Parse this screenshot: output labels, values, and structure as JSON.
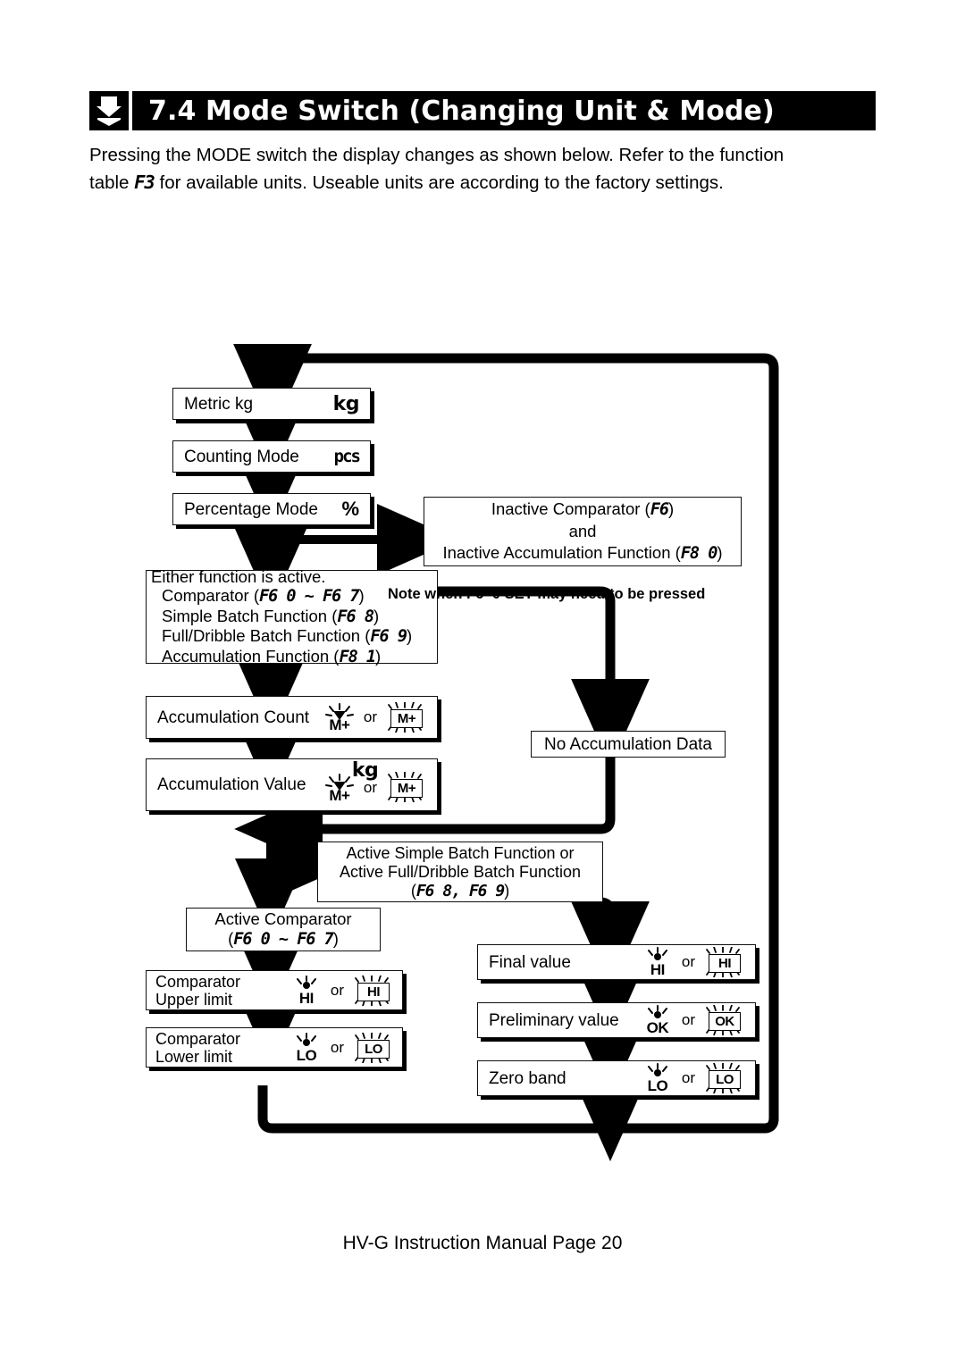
{
  "header": {
    "title": "7.4 Mode Switch (Changing Unit & Mode)",
    "icon": "down-arrow-mark-icon"
  },
  "intro": {
    "line1_a": "Pressing the MODE switch the display changes as shown below. Refer to the function",
    "line2_a": "table ",
    "line2_code": "F3",
    "line2_b": " for available units. Useable units are according to the factory settings."
  },
  "flow": {
    "boxes": {
      "metric_kg": {
        "label": "Metric kg",
        "unit": "kg"
      },
      "counting_mode": {
        "label": "Counting Mode",
        "unit": "pcs"
      },
      "percentage_mode": {
        "label": "Percentage Mode",
        "unit": "%"
      },
      "inactive": {
        "line1_a": "Inactive Comparator (",
        "line1_code": "F6",
        "line1_b": ")",
        "line2": "and",
        "line3_a": "Inactive Accumulation Function (",
        "line3_code": "F8  0",
        "line3_b": ")"
      },
      "either_active": {
        "title": "Either function is active.",
        "rows": [
          {
            "text_a": "Comparator (",
            "code": "F6  0 ~ F6  7",
            "text_b": ")"
          },
          {
            "text_a": "Simple Batch Function (",
            "code": "F6  8",
            "text_b": ")"
          },
          {
            "text_a": "Full/Dribble Batch Function (",
            "code": "F6  9",
            "text_b": ")"
          },
          {
            "text_a": "Accumulation Function (",
            "code": "F8  1",
            "text_b": ")"
          }
        ]
      },
      "note": "Note when F6=0 SET may need to be pressed",
      "accum_count": {
        "label": "Accumulation Count",
        "flash_label": "M+",
        "or": "or",
        "boxed_label": "M+"
      },
      "accum_value": {
        "label": "Accumulation Value",
        "unit": "kg",
        "flash_label": "M+",
        "or": "or",
        "boxed_label": "M+"
      },
      "no_accum_data": {
        "label": "No Accumulation Data"
      },
      "active_batch": {
        "line1": "Active Simple Batch Function  or",
        "line2": "Active Full/Dribble Batch Function",
        "line3_a": "(",
        "line3_code": "F6  8, F6  9",
        "line3_b": ")"
      },
      "active_comparator": {
        "line1": "Active Comparator",
        "line2_a": "(",
        "line2_code": "F6  0 ~ F6  7",
        "line2_b": ")"
      },
      "comp_upper": {
        "line1": "Comparator",
        "line2": "Upper limit",
        "flash_label": "HI",
        "or": "or",
        "boxed_label": "HI"
      },
      "comp_lower": {
        "line1": "Comparator",
        "line2": "Lower limit",
        "flash_label": "LO",
        "or": "or",
        "boxed_label": "LO"
      },
      "final_value": {
        "label": "Final value",
        "flash_label": "HI",
        "or": "or",
        "boxed_label": "HI"
      },
      "preliminary_value": {
        "label": "Preliminary value",
        "flash_label": "OK",
        "or": "or",
        "boxed_label": "OK"
      },
      "zero_band": {
        "label": "Zero band",
        "flash_label": "LO",
        "or": "or",
        "boxed_label": "LO"
      }
    }
  },
  "footer": {
    "text": "HV-G Instruction Manual Page 20"
  },
  "colors": {
    "ink": "#000000",
    "paper": "#ffffff"
  }
}
